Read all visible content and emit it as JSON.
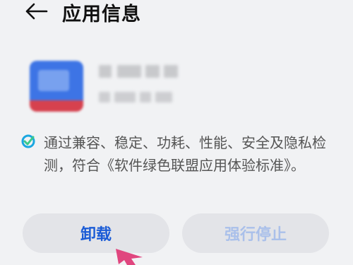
{
  "header": {
    "title": "应用信息",
    "back_icon": "arrow-left-icon"
  },
  "app": {
    "icon": "app-icon-blurred",
    "colors": {
      "primary": "#3d74e5",
      "secondary": "#78a1ef",
      "stripe": "#d6414e"
    }
  },
  "certification": {
    "icon": "shield-check-icon",
    "text": "通过兼容、稳定、功耗、性能、安全及隐私检测，符合《软件绿色联盟应用体验标准》。",
    "icon_colors": [
      "#1ba7e0",
      "#3cc98a"
    ]
  },
  "actions": {
    "uninstall_label": "卸载",
    "force_stop_label": "强行停止",
    "force_stop_disabled": true
  },
  "colors": {
    "accent": "#1a5bd6",
    "disabled_text": "#aac0ea",
    "button_bg": "#e3e4e8",
    "pointer": "#e0467f"
  }
}
